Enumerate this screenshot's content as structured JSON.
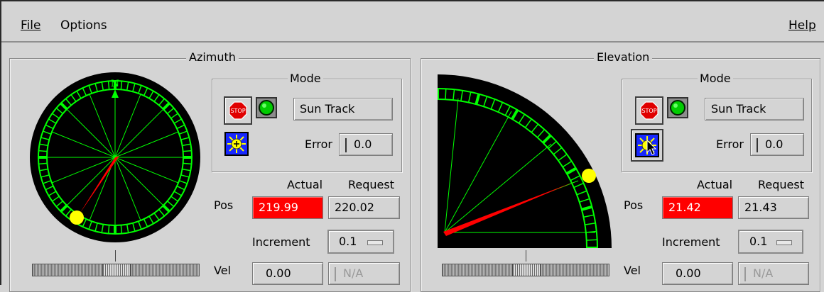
{
  "menubar": {
    "file": "File",
    "options": "Options",
    "help": "Help"
  },
  "azimuth": {
    "title": "Azimuth",
    "compass_north": "N",
    "mode_title": "Mode",
    "stop_label": "STOP",
    "mode_value": "Sun Track",
    "error_label": "Error",
    "error_value": "0.0",
    "actual_header": "Actual",
    "request_header": "Request",
    "pos_label": "Pos",
    "pos_actual": "219.99",
    "pos_request": "220.02",
    "increment_label": "Increment",
    "increment_value": "0.1",
    "vel_label": "Vel",
    "vel_actual": "0.00",
    "vel_request": "N/A",
    "slider_position": 0.5,
    "status_led": "green"
  },
  "elevation": {
    "title": "Elevation",
    "mode_title": "Mode",
    "stop_label": "STOP",
    "mode_value": "Sun Track",
    "error_label": "Error",
    "error_value": "0.0",
    "actual_header": "Actual",
    "request_header": "Request",
    "pos_label": "Pos",
    "pos_actual": "21.42",
    "pos_request": "21.43",
    "increment_label": "Increment",
    "increment_value": "0.1",
    "vel_label": "Vel",
    "vel_actual": "0.00",
    "vel_request": "N/A",
    "slider_position": 0.5,
    "status_led": "green"
  },
  "colors": {
    "background": "#d4d4d4",
    "dial_bg": "#000000",
    "dial_green": "#00ff00",
    "needle_red": "#ff0000",
    "sun_yellow": "#ffff00",
    "sun_button_blue": "#1727ff",
    "pos_actual_bg": "#ff0000"
  },
  "icons": {
    "stop": "stop-sign-icon",
    "led": "green-led-icon",
    "sun": "sun-icon",
    "cursor": "mouse-pointer-icon",
    "option": "option-menu-indicator-icon"
  }
}
